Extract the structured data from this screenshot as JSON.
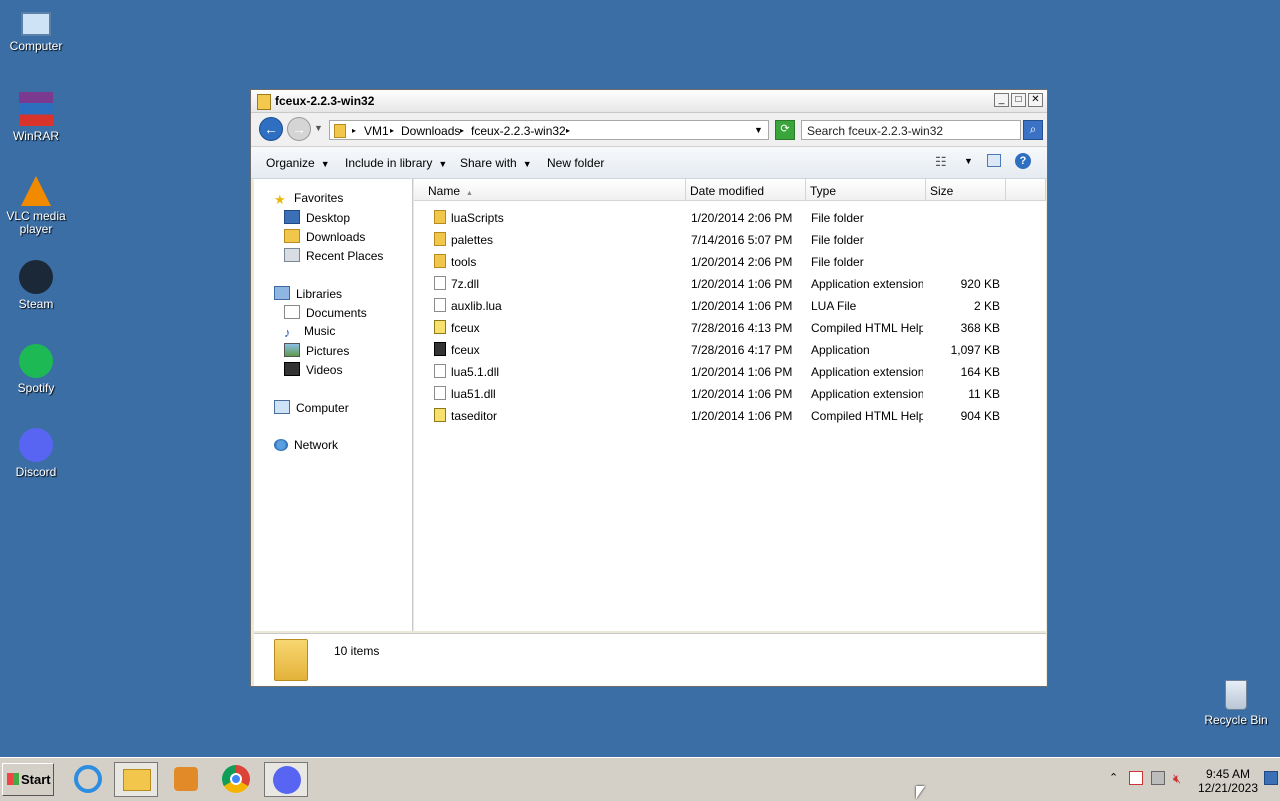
{
  "desktop": {
    "icons": [
      {
        "label": "Computer"
      },
      {
        "label": "WinRAR"
      },
      {
        "label": "VLC media player"
      },
      {
        "label": "Steam"
      },
      {
        "label": "Spotify"
      },
      {
        "label": "Discord"
      },
      {
        "label": "Recycle Bin"
      }
    ]
  },
  "window": {
    "title": "fceux-2.2.3-win32",
    "breadcrumb": [
      "VM1",
      "Downloads",
      "fceux-2.2.3-win32"
    ],
    "search_placeholder": "Search fceux-2.2.3-win32",
    "toolbar": {
      "organize": "Organize",
      "include": "Include in library",
      "share": "Share with",
      "new_folder": "New folder"
    },
    "nav": {
      "favorites": "Favorites",
      "desktop": "Desktop",
      "downloads": "Downloads",
      "recent": "Recent Places",
      "libraries": "Libraries",
      "documents": "Documents",
      "music": "Music",
      "pictures": "Pictures",
      "videos": "Videos",
      "computer": "Computer",
      "network": "Network"
    },
    "columns": {
      "name": "Name",
      "date": "Date modified",
      "type": "Type",
      "size": "Size"
    },
    "files": [
      {
        "name": "luaScripts",
        "date": "1/20/2014 2:06 PM",
        "type": "File folder",
        "size": "",
        "icon": "folder"
      },
      {
        "name": "palettes",
        "date": "7/14/2016 5:07 PM",
        "type": "File folder",
        "size": "",
        "icon": "folder"
      },
      {
        "name": "tools",
        "date": "1/20/2014 2:06 PM",
        "type": "File folder",
        "size": "",
        "icon": "folder"
      },
      {
        "name": "7z.dll",
        "date": "1/20/2014 1:06 PM",
        "type": "Application extension",
        "size": "920 KB",
        "icon": "file"
      },
      {
        "name": "auxlib.lua",
        "date": "1/20/2014 1:06 PM",
        "type": "LUA File",
        "size": "2 KB",
        "icon": "file"
      },
      {
        "name": "fceux",
        "date": "7/28/2016 4:13 PM",
        "type": "Compiled HTML Help...",
        "size": "368 KB",
        "icon": "help"
      },
      {
        "name": "fceux",
        "date": "7/28/2016 4:17 PM",
        "type": "Application",
        "size": "1,097 KB",
        "icon": "app"
      },
      {
        "name": "lua5.1.dll",
        "date": "1/20/2014 1:06 PM",
        "type": "Application extension",
        "size": "164 KB",
        "icon": "file"
      },
      {
        "name": "lua51.dll",
        "date": "1/20/2014 1:06 PM",
        "type": "Application extension",
        "size": "11 KB",
        "icon": "file"
      },
      {
        "name": "taseditor",
        "date": "1/20/2014 1:06 PM",
        "type": "Compiled HTML Help...",
        "size": "904 KB",
        "icon": "help"
      }
    ],
    "item_count": "10 items"
  },
  "taskbar": {
    "start": "Start",
    "time": "9:45 AM",
    "date": "12/21/2023"
  }
}
